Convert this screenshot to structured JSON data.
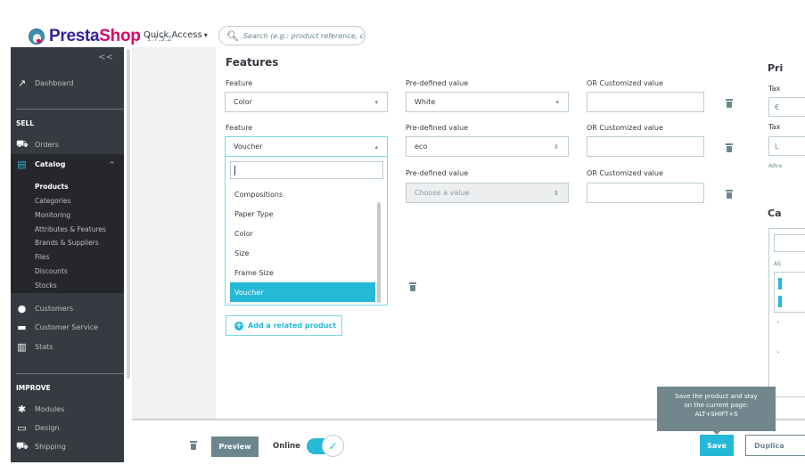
{
  "header": {
    "brand_part1": "Presta",
    "brand_part2": "Shop",
    "version": "1.7.5.2",
    "quick_access": "Quick Access",
    "search_placeholder": "Search (e.g.: product reference, custome"
  },
  "sidebar": {
    "collapse": "<<",
    "dashboard": "Dashboard",
    "sell_section": "SELL",
    "orders": "Orders",
    "catalog": "Catalog",
    "catalog_sub": [
      "Products",
      "Categories",
      "Monitoring",
      "Attributes & Features",
      "Brands & Suppliers",
      "Files",
      "Discounts",
      "Stocks"
    ],
    "customers": "Customers",
    "customer_service": "Customer Service",
    "stats": "Stats",
    "improve_section": "IMPROVE",
    "modules": "Modules",
    "design": "Design",
    "shipping": "Shipping"
  },
  "features": {
    "title": "Features",
    "feature_label": "Feature",
    "predefined_label": "Pre-defined value",
    "custom_label": "OR Customized value",
    "rows": [
      {
        "feature": "Color",
        "predefined": "White",
        "custom": ""
      },
      {
        "feature": "Voucher",
        "predefined": "eco",
        "custom": ""
      },
      {
        "feature": "",
        "predefined": "Choose a value",
        "custom": ""
      }
    ],
    "dropdown_search_value": "",
    "dropdown_options": [
      "Compositions",
      "Paper Type",
      "Color",
      "Size",
      "Frame Size",
      "Voucher"
    ],
    "dropdown_selected": "Voucher",
    "add_related": "Add a related product"
  },
  "right_column": {
    "price_title": "Pri",
    "tax_label1": "Tax",
    "currency": "€",
    "tax_label2": "Tax",
    "tax_value": "L",
    "advanced": "Adva",
    "cat_title": "Ca",
    "assoc": "AS"
  },
  "footer": {
    "preview": "Preview",
    "online": "Online",
    "online_state": true,
    "save": "Save",
    "duplicate": "Duplica",
    "tooltip_lines": [
      "Save the product and stay",
      "on the current page:",
      "ALT+SHIFT+S"
    ]
  },
  "colors": {
    "accent": "#25b9d7",
    "sidebar_bg": "#363a41",
    "secondary": "#6c868e"
  }
}
